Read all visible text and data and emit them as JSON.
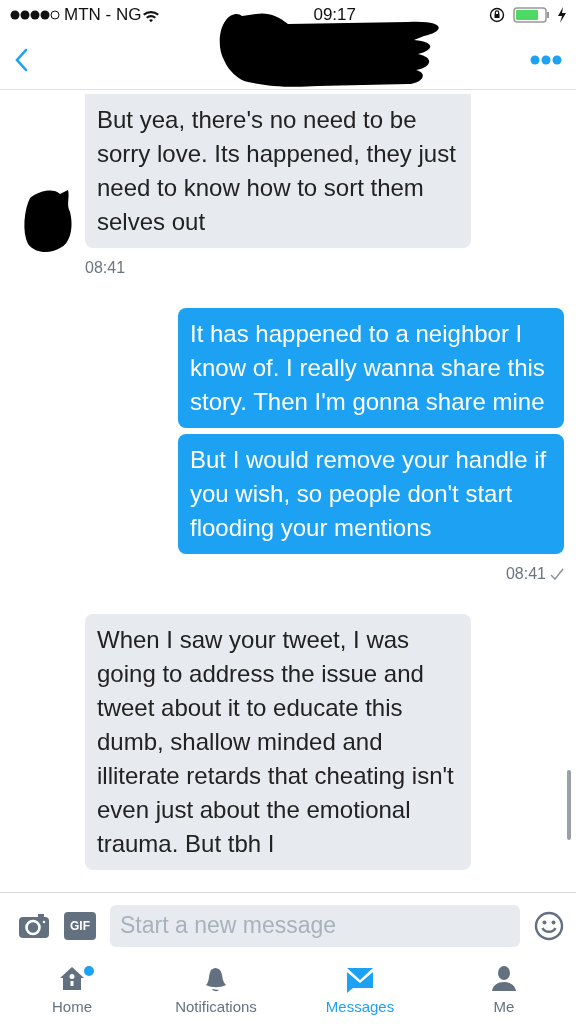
{
  "status_bar": {
    "carrier": "MTN - NG",
    "time": "09:17"
  },
  "messages": [
    {
      "kind": "received",
      "text": "But yea, there's no need to be sorry love. Its happened, they just need to know how to sort them selves out",
      "avatar": true,
      "time": "08:41"
    },
    {
      "kind": "sent",
      "text": "It has happened to a neighbor I know of. I really wanna share this story. Then I'm gonna share mine"
    },
    {
      "kind": "sent",
      "text": "But I would remove your handle if you wish, so people don't start flooding your mentions",
      "time": "08:41",
      "read": true
    },
    {
      "kind": "received",
      "text": "When I saw your tweet, I was going to address the issue and tweet about it to educate this dumb, shallow minded and illiterate retards that cheating isn't even just about the emotional trauma. But tbh I",
      "avatar": false
    }
  ],
  "composer": {
    "gif_label": "GIF",
    "placeholder": "Start a new message"
  },
  "tabs": [
    {
      "label": "Home",
      "kind": "home",
      "selected": false,
      "unread": true
    },
    {
      "label": "Notifications",
      "kind": "bell",
      "selected": false,
      "unread": false
    },
    {
      "label": "Messages",
      "kind": "mail",
      "selected": true,
      "unread": false
    },
    {
      "label": "Me",
      "kind": "person",
      "selected": false,
      "unread": false
    }
  ]
}
